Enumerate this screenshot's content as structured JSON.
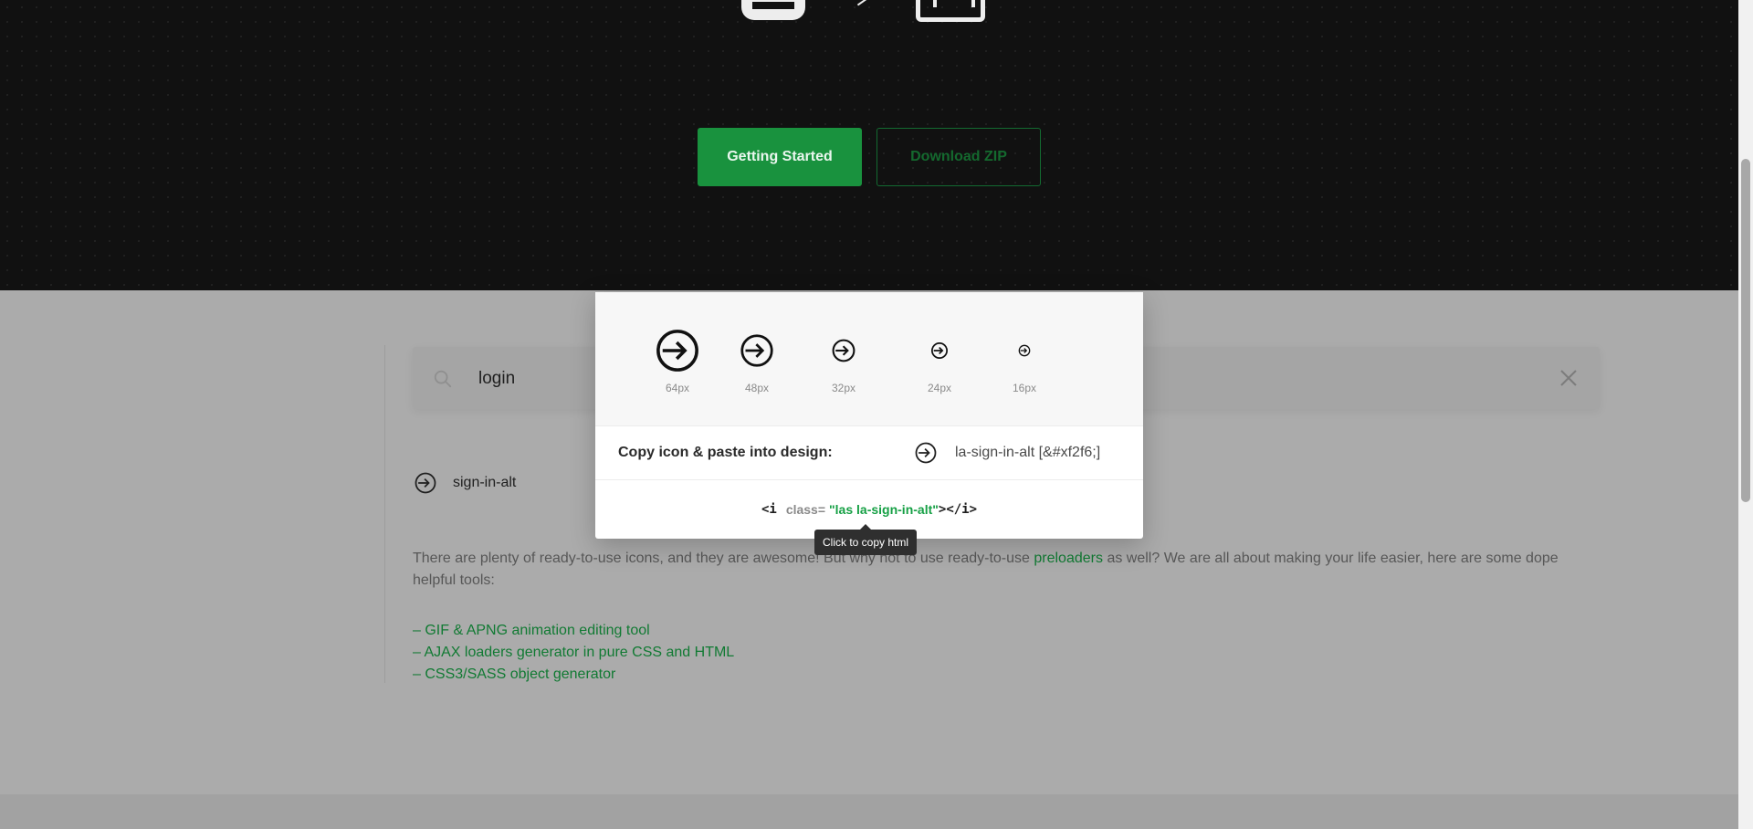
{
  "hero": {
    "primary_button": "Getting Started",
    "secondary_button": "Download ZIP",
    "icons": [
      "car-icon",
      "arrow-icon",
      "van-icon"
    ]
  },
  "search": {
    "value": "login",
    "placeholder": "",
    "search_icon": "search-icon",
    "clear_icon": "close-icon"
  },
  "results": [
    {
      "icon": "sign-in-alt-icon",
      "label": "sign-in-alt"
    }
  ],
  "popup": {
    "sizes": [
      "64px",
      "48px",
      "32px",
      "24px",
      "16px"
    ],
    "copy_label": "Copy icon & paste into design:",
    "copy_code": "la-sign-in-alt [&#xf2f6;]",
    "html_open": "<i",
    "html_attr": "class=",
    "html_value": "\"las la-sign-in-alt\"",
    "html_close": "></i>",
    "tooltip": "Click to copy html"
  },
  "content": {
    "para_before": "There are plenty of ready-to-use icons, and they are awesome! But why not to use ready-to-use",
    "para_link": "preloaders",
    "para_after": "as well? We are all about making your life easier, here are some dope helpful tools:",
    "tools": [
      "– GIF & APNG animation editing tool",
      "– AJAX loaders generator in pure CSS and HTML",
      "– CSS3/SASS object generator"
    ]
  },
  "colors": {
    "accent": "#19923e",
    "link": "#117a33",
    "hero_bg": "#111111",
    "overlay_bg": "#ababab"
  }
}
